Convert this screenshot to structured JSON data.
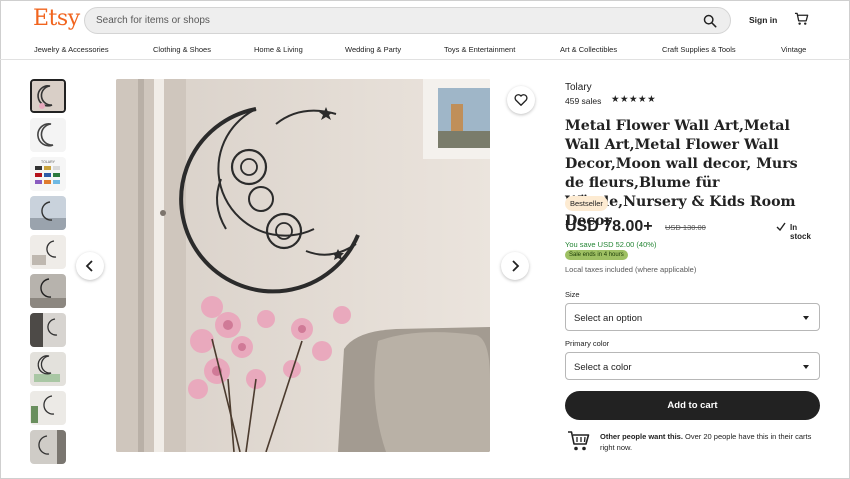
{
  "header": {
    "logo": "Etsy",
    "search_placeholder": "Search for items or shops",
    "signin_label": "Sign in"
  },
  "categories": [
    "Jewelry & Accessories",
    "Clothing & Shoes",
    "Home & Living",
    "Wedding & Party",
    "Toys & Entertainment",
    "Art & Collectibles",
    "Craft Supplies & Tools",
    "Vintage"
  ],
  "gallery": {
    "thumbnail_count": 10,
    "selected_index": 0
  },
  "thumb_label": "TOLARY",
  "product": {
    "shop_name": "Tolary",
    "sales": "459 sales",
    "rating_stars": "★★★★★",
    "title": "Metal Flower Wall Art,Metal Wall Art,Metal Flower Wall Decor,Moon wall decor, Murs de fleurs,Blume für Wände,Nursery & Kids Room Decor",
    "badge": "Bestseller",
    "price": "USD 78.00+",
    "original_price": "USD 130.00",
    "stock": "In stock",
    "saving": "You save USD 52.00 (40%)",
    "sale_ends": "Sale ends in 4 hours",
    "taxes": "Local taxes included (where applicable)"
  },
  "options": {
    "size_label": "Size",
    "size_value": "Select an option",
    "color_label": "Primary color",
    "color_value": "Select a color"
  },
  "cart": {
    "add_label": "Add to cart",
    "demand_bold": "Other people want this.",
    "demand_text": " Over 20 people have this in their carts right now."
  },
  "colors": {
    "brand": "#f1641e",
    "button": "#222222",
    "saving_text": "#258635",
    "sale_badge": "#9ec063",
    "bestseller_badge": "#fdebd2"
  }
}
